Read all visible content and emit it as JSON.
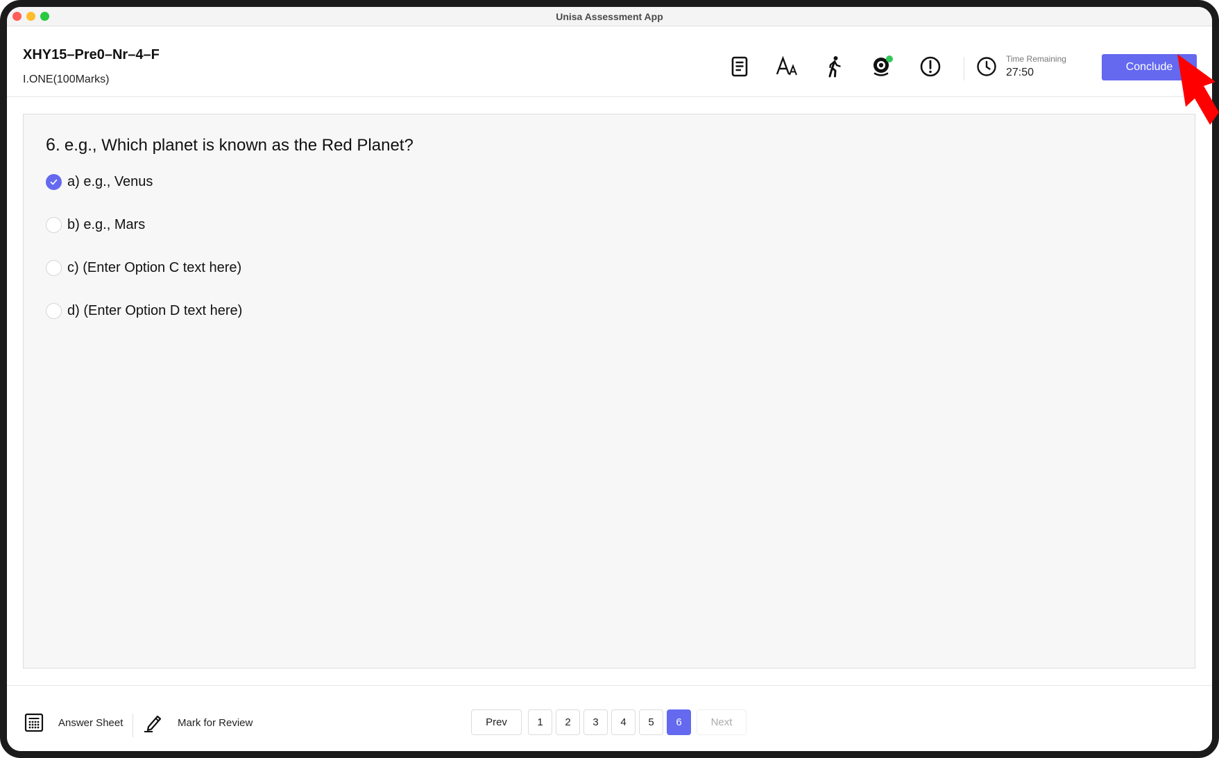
{
  "window": {
    "title": "Unisa Assessment App"
  },
  "exam": {
    "code": "XHY15–Pre0–Nr–4–F",
    "section": "I.ONE(100Marks)"
  },
  "toolbar": {
    "icons": [
      "notes-icon",
      "font-size-icon",
      "accessibility-icon",
      "webcam-icon",
      "alert-icon"
    ],
    "webcam_status_color": "#34c759"
  },
  "timer": {
    "label": "Time Remaining",
    "value": "27:50"
  },
  "conclude": {
    "label": "Conclude"
  },
  "question": {
    "number": "6.",
    "text": "e.g., Which planet is known as the Red Planet?",
    "options": [
      {
        "label": "a) e.g., Venus",
        "selected": true
      },
      {
        "label": "b) e.g., Mars",
        "selected": false
      },
      {
        "label": "c) (Enter Option C text here)",
        "selected": false
      },
      {
        "label": "d) (Enter Option D text here)",
        "selected": false
      }
    ]
  },
  "footer": {
    "answer_sheet_label": "Answer Sheet",
    "mark_review_label": "Mark for Review",
    "prev_label": "Prev",
    "next_label": "Next",
    "pages": [
      "1",
      "2",
      "3",
      "4",
      "5",
      "6"
    ],
    "current_page": "6"
  },
  "colors": {
    "accent": "#6469f0",
    "pointer": "#ff0000"
  }
}
